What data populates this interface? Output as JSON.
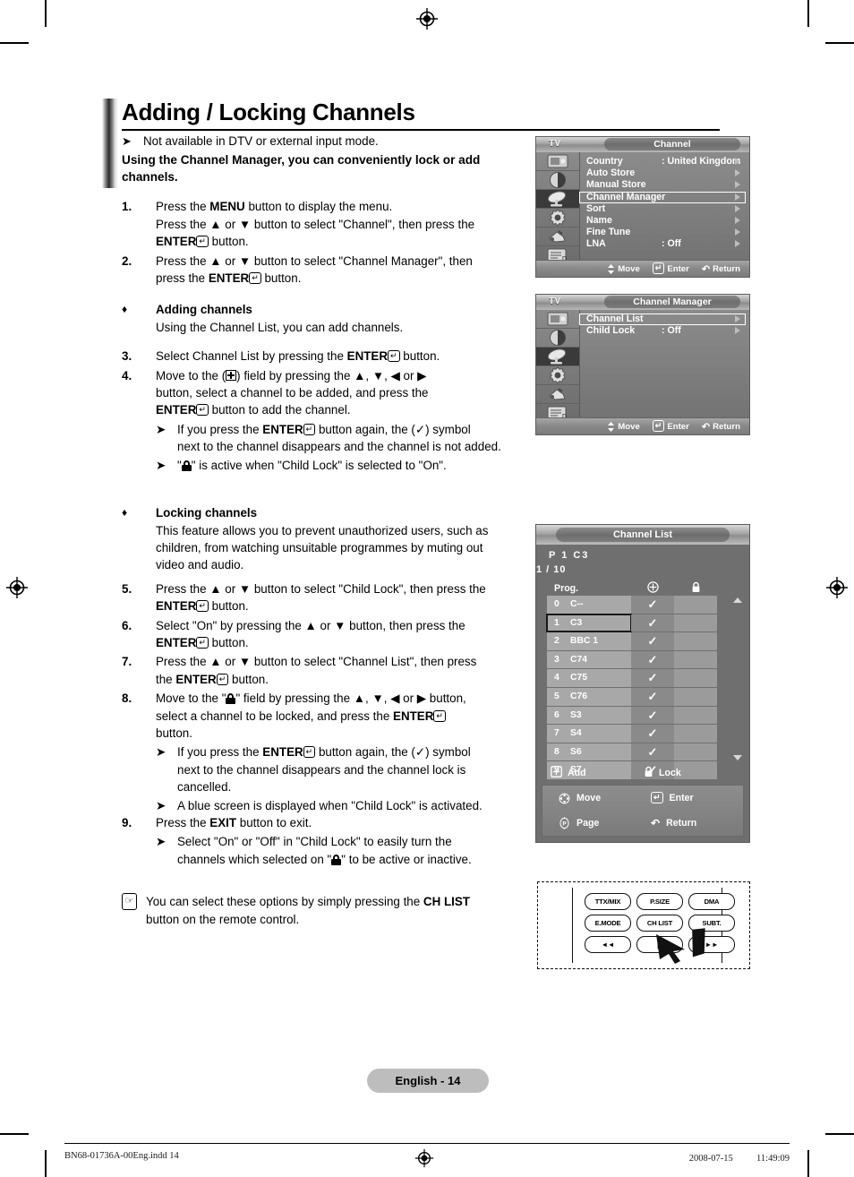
{
  "document": {
    "title": "Adding / Locking Channels",
    "page_badge": "English - 14",
    "footer_left": "BN68-01736A-00Eng.indd   14",
    "footer_right": "2008-07-15   　　 11:49:09"
  },
  "intro": {
    "note": "Not available in DTV or external input mode.",
    "lead_line1": "Using the Channel Manager, you can conveniently lock or add",
    "lead_line2": "channels."
  },
  "steps": {
    "s1_num": "1.",
    "s1_l1": "Press the MENU button to display the menu.",
    "s1_l1_pre": "Press the ",
    "s1_l1_b": "MENU",
    "s1_l1_post": " button to display the menu.",
    "s1_l2_pre": "Press the ▲ or ▼ button to select \"Channel\", then press the",
    "s1_l3_b": "ENTER",
    "s1_l3_post": " button.",
    "s2_num": "2.",
    "s2_l1": "Press the ▲ or ▼ button to select \"Channel Manager\", then",
    "s2_l2_pre": "press the ",
    "s2_l2_b": "ENTER",
    "s2_l2_post": " button.",
    "s3_num": "3.",
    "s3_pre": "Select Channel List by pressing the ",
    "s3_b": "ENTER",
    "s3_post": " button.",
    "s4_num": "4.",
    "s4_l1_pre": "Move to the (",
    "s4_l1_post": ") field by pressing the ▲, ▼, ◀ or ▶",
    "s4_l2": "button, select a channel to be added, and press the",
    "s4_l3_b": "ENTER",
    "s4_l3_post": " button to add the channel.",
    "s4_note1_pre": "If you press the ",
    "s4_note1_b": "ENTER",
    "s4_note1_mid": " button again, the (✓) symbol",
    "s4_note1_l2": "next to the channel disappears and the channel is not added.",
    "s4_note2_pre": "\"",
    "s4_note2_post": "\" is active when \"Child Lock\" is selected to \"On\".",
    "s5_num": "5.",
    "s5_l1": "Press the ▲ or ▼ button to select \"Child Lock\", then press the",
    "s5_l2_b": "ENTER",
    "s5_l2_post": " button.",
    "s6_num": "6.",
    "s6_l1": "Select \"On\" by pressing the ▲ or ▼ button, then press the",
    "s6_l2_b": "ENTER",
    "s6_l2_post": " button.",
    "s7_num": "7.",
    "s7_l1": "Press the ▲ or ▼ button to select \"Channel List\", then press",
    "s7_l2_pre": "the ",
    "s7_l2_b": "ENTER",
    "s7_l2_post": " button.",
    "s8_num": "8.",
    "s8_l1_pre": "Move to the \"",
    "s8_l1_post": "\" field by pressing the ▲, ▼, ◀ or ▶ button,",
    "s8_l2_pre": "select a channel to be locked, and press the ",
    "s8_l2_b": "ENTER",
    "s8_l3": "button.",
    "s8_note1_pre": "If you press the ",
    "s8_note1_b": "ENTER",
    "s8_note1_mid": " button again, the (✓) symbol",
    "s8_note1_l2": "next to the channel disappears and the channel lock is",
    "s8_note1_l3": "cancelled.",
    "s8_note2": "A blue screen is displayed when \"Child Lock\" is activated.",
    "s9_num": "9.",
    "s9_pre": "Press the ",
    "s9_b": "EXIT",
    "s9_post": " button to exit.",
    "s9_note_l1": "Select \"On\" or \"Off\" in \"Child Lock\" to easily turn the",
    "s9_note_l2_pre": "channels which selected on \"",
    "s9_note_l2_post": "\" to be active or inactive."
  },
  "bullets": {
    "adding_head": "Adding channels",
    "adding_body": "Using the Channel List, you can add channels.",
    "locking_head": "Locking channels",
    "locking_l1": "This feature allows you to prevent unauthorized users, such as",
    "locking_l2": "children, from watching unsuitable programmes by muting out",
    "locking_l3": "video and audio."
  },
  "tip": {
    "l1_pre": "You can select these options by simply pressing the ",
    "l1_b": "CH LIST",
    "l2": "button on the remote control."
  },
  "osd_channel": {
    "tv_label": "TV",
    "title": "Channel",
    "rows": [
      {
        "label": "Country",
        "value": ": United Kingdom",
        "arrow": true,
        "selected": false
      },
      {
        "label": "Auto Store",
        "value": "",
        "arrow": true,
        "selected": false
      },
      {
        "label": "Manual Store",
        "value": "",
        "arrow": true,
        "selected": false
      },
      {
        "label": "Channel Manager",
        "value": "",
        "arrow": true,
        "selected": true
      },
      {
        "label": "Sort",
        "value": "",
        "arrow": true,
        "selected": false
      },
      {
        "label": "Name",
        "value": "",
        "arrow": true,
        "selected": false
      },
      {
        "label": "Fine Tune",
        "value": "",
        "arrow": true,
        "selected": false
      },
      {
        "label": "LNA",
        "value": ": Off",
        "arrow": true,
        "selected": false
      }
    ],
    "footer": [
      {
        "icon": "updown-icon",
        "label": "Move"
      },
      {
        "icon": "enter-icon",
        "label": "Enter"
      },
      {
        "icon": "return-icon",
        "label": "Return"
      }
    ],
    "side_icons": [
      "picture-icon",
      "sound-icon",
      "channel-dish-icon",
      "setup-gear-icon",
      "input-plug-icon",
      "pc-setup-icon"
    ],
    "active_side_index": 2
  },
  "osd_channel_manager": {
    "tv_label": "TV",
    "title": "Channel Manager",
    "rows": [
      {
        "label": "Channel List",
        "value": "",
        "arrow": true,
        "selected": true
      },
      {
        "label": "Child Lock",
        "value": ": Off",
        "arrow": true,
        "selected": false
      }
    ],
    "footer": [
      {
        "icon": "updown-icon",
        "label": "Move"
      },
      {
        "icon": "enter-icon",
        "label": "Enter"
      },
      {
        "icon": "return-icon",
        "label": "Return"
      }
    ],
    "side_icons": [
      "picture-icon",
      "sound-icon",
      "channel-dish-icon",
      "setup-gear-icon",
      "input-plug-icon",
      "pc-setup-icon"
    ],
    "active_side_index": 2
  },
  "channel_list": {
    "title": "Channel List",
    "current": "P  1  C3",
    "page_indicator": "1 / 10",
    "col_prog": "Prog.",
    "col_add_icon": "plus-box-icon",
    "col_lock_icon": "lock-icon",
    "rows": [
      {
        "num": "0",
        "name": "C--",
        "added": "✓",
        "locked": "",
        "cursor": false
      },
      {
        "num": "1",
        "name": "C3",
        "added": "✓",
        "locked": "",
        "cursor": true
      },
      {
        "num": "2",
        "name": "BBC 1",
        "added": "✓",
        "locked": "",
        "cursor": false
      },
      {
        "num": "3",
        "name": "C74",
        "added": "✓",
        "locked": "",
        "cursor": false
      },
      {
        "num": "4",
        "name": "C75",
        "added": "✓",
        "locked": "",
        "cursor": false
      },
      {
        "num": "5",
        "name": "C76",
        "added": "✓",
        "locked": "",
        "cursor": false
      },
      {
        "num": "6",
        "name": "S3",
        "added": "✓",
        "locked": "",
        "cursor": false
      },
      {
        "num": "7",
        "name": "S4",
        "added": "✓",
        "locked": "",
        "cursor": false
      },
      {
        "num": "8",
        "name": "S6",
        "added": "✓",
        "locked": "",
        "cursor": false
      },
      {
        "num": "9",
        "name": "S7",
        "added": "✓",
        "locked": "",
        "cursor": false
      }
    ],
    "legend_add": "Add",
    "legend_lock": "Lock",
    "footer": [
      {
        "icon": "move-pad-icon",
        "label": "Move"
      },
      {
        "icon": "enter-icon",
        "label": "Enter"
      },
      {
        "icon": "page-icon",
        "label": "Page"
      },
      {
        "icon": "return-icon",
        "label": "Return"
      }
    ]
  },
  "remote": {
    "buttons": [
      "TTX/MIX",
      "P.SIZE",
      "DMA",
      "E.MODE",
      "CH LIST",
      "SUBT.",
      "◄◄",
      "▐▐",
      "►►"
    ],
    "highlight": "CH LIST"
  },
  "colors": {
    "osd_bg": "#7e7e7e",
    "osd_row_bg": "#a8a8a8",
    "osd_check_col": "#8a8a8a",
    "osd_lock_col": "#9b9b9b",
    "badge_bg": "#bdbdbd",
    "cursor": "#1a1a1a"
  }
}
